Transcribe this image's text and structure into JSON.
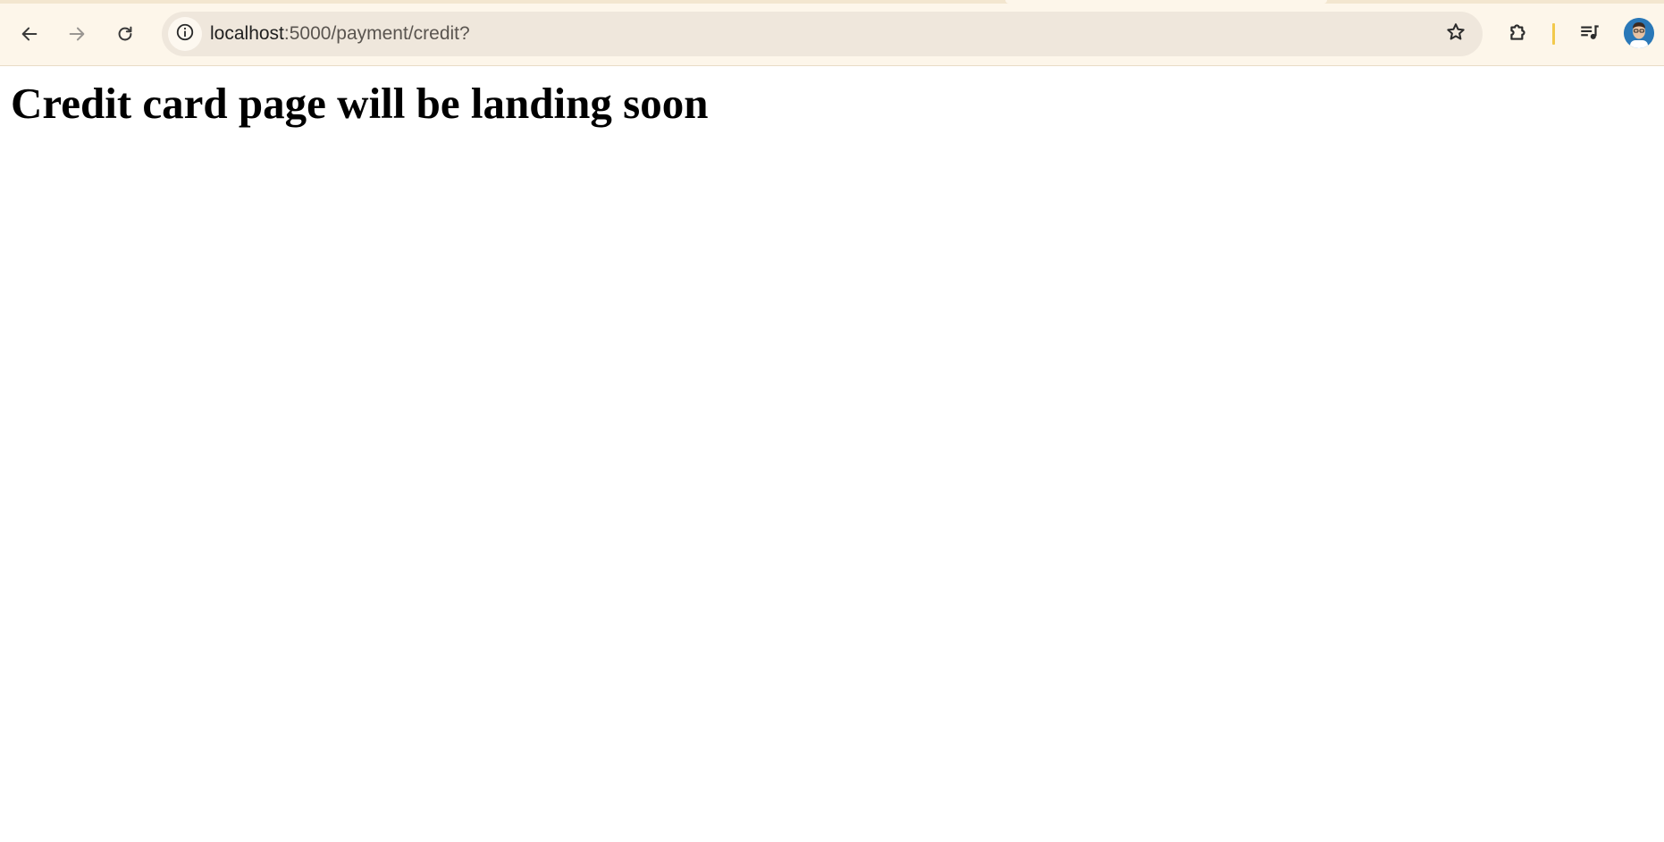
{
  "browser": {
    "omnibox": {
      "url_host": "localhost",
      "url_rest": ":5000/payment/credit?"
    },
    "icons": {
      "back": "arrow-left-icon",
      "forward": "arrow-right-icon",
      "reload": "reload-icon",
      "site_info": "info-circle-icon",
      "bookmark": "star-outline-icon",
      "extensions": "puzzle-icon",
      "media": "playlist-music-icon",
      "profile": "avatar"
    },
    "colors": {
      "toolbar_bg": "#fdf6ea",
      "omnibox_bg": "#efe7dc",
      "divider": "#f2c94c"
    }
  },
  "page": {
    "heading": "Credit card page will be landing soon"
  }
}
